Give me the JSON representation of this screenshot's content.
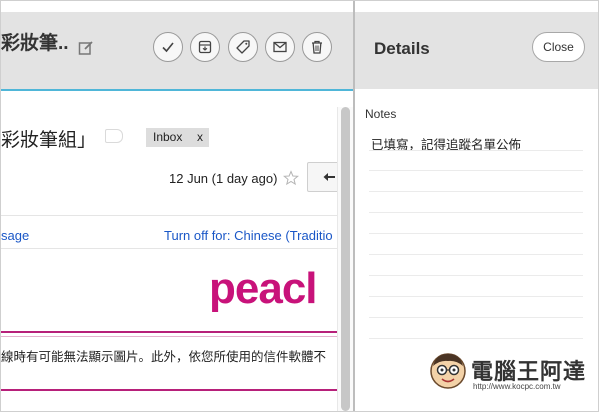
{
  "message": {
    "header_subject": "彩妝筆..",
    "subject": "彩妝筆組」",
    "label_chip": "Inbox",
    "label_chip_remove": "x",
    "date": "12 Jun (1 day ago)",
    "translate_message_link": "sage",
    "turn_off_link": "Turn off for: Chinese (Traditio",
    "brand_logo_text": "peacl",
    "notice_text": "線時有可能無法顯示圖片。此外，依您所使用的信件軟體不"
  },
  "toolbar": {
    "buttons": [
      {
        "name": "done-button",
        "icon": "check-icon"
      },
      {
        "name": "archive-button",
        "icon": "archive-icon"
      },
      {
        "name": "label-button",
        "icon": "tag-icon"
      },
      {
        "name": "mail-button",
        "icon": "envelope-icon"
      },
      {
        "name": "delete-button",
        "icon": "trash-icon"
      }
    ]
  },
  "details": {
    "title": "Details",
    "close_label": "Close",
    "notes_label": "Notes",
    "note_text": "已填寫，記得追蹤名單公佈"
  },
  "watermark": {
    "title": "電腦王阿達",
    "url": "http://www.kocpc.com.tw"
  },
  "colors": {
    "accent_line": "#4fb6d8",
    "link": "#1a57c7",
    "brand": "#c8127a",
    "header_bg": "#e3e3e3"
  }
}
